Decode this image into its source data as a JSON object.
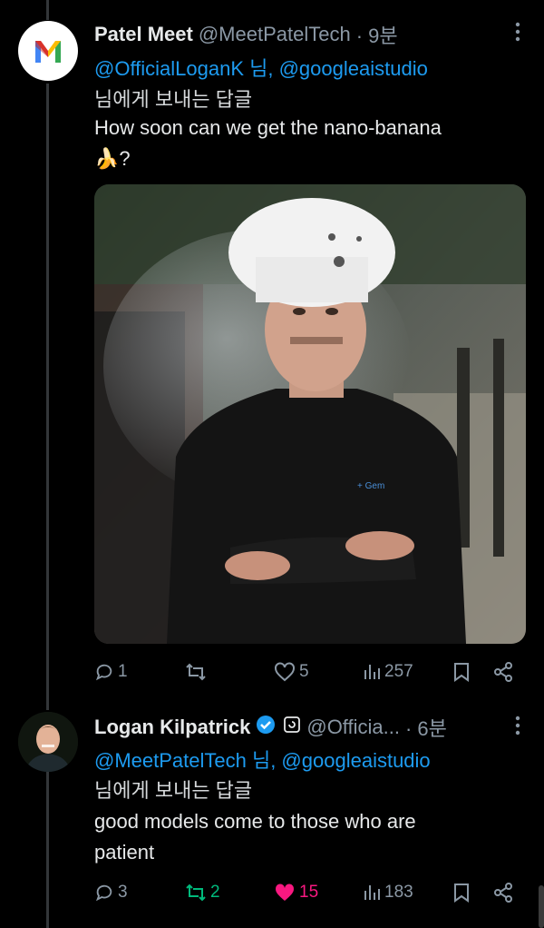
{
  "tweets": [
    {
      "name": "Patel Meet",
      "handle": "@MeetPatelTech",
      "time": "· 9분",
      "reply_to": "@OfficialLoganK 님, @googleaistudio",
      "reply_suffix": "님에게 보내는 답글",
      "text_line1": "How soon can we get the nano-banana",
      "text_line2": "🍌?",
      "actions": {
        "replies": "1",
        "reposts": "",
        "likes": "5",
        "views": "257"
      },
      "avatar_icon": "gmail-logo-icon",
      "media_desc": "chef-photo"
    },
    {
      "name": "Logan Kilpatrick",
      "handle": "@Officia...",
      "time": "· 6분",
      "reply_to": "@MeetPatelTech 님, @googleaistudio",
      "reply_suffix": "님에게 보내는 답글",
      "text_line1": "good models come to those who are",
      "text_line2": "patient",
      "actions": {
        "replies": "3",
        "reposts": "2",
        "likes": "15",
        "views": "183"
      },
      "verified": true
    }
  ],
  "colors": {
    "background": "#000000",
    "link": "#1d9bf0",
    "muted": "#8b98a5",
    "like_active": "#f91880",
    "repost_active": "#00ba7c",
    "verified": "#1d9bf0"
  }
}
